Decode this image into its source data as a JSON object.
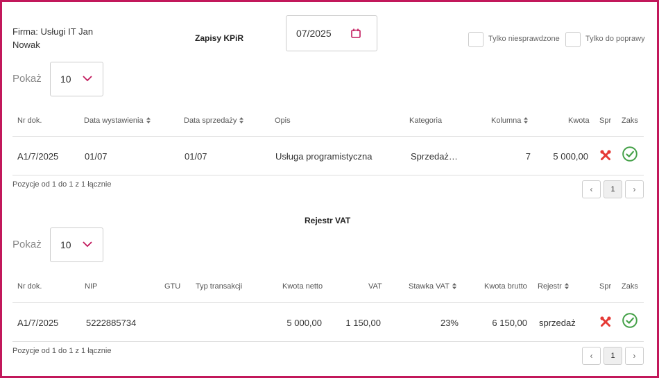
{
  "header": {
    "company": "Firma: Usługi IT Jan Nowak",
    "kpir_title": "Zapisy KPiR",
    "month": "07/2025",
    "filter_unchecked_label": "Tylko niesprawdzone",
    "filter_to_fix_label": "Tylko do poprawy"
  },
  "kpir": {
    "show_label": "Pokaż",
    "page_size": "10",
    "columns": [
      "Nr dok.",
      "Data wystawienia",
      "Data sprzedaży",
      "Opis",
      "Kategoria",
      "Kolumna",
      "Kwota",
      "Spr",
      "Zaks"
    ],
    "rows": [
      {
        "nr": "A1/7/2025",
        "issue_date": "01/07",
        "sale_date": "01/07",
        "description": "Usługa programistyczna",
        "category": "Sprzedaż…",
        "column": "7",
        "amount": "5 000,00"
      }
    ],
    "info": "Pozycje od 1 do 1 z 1 łącznie",
    "page": "1"
  },
  "vat": {
    "title": "Rejestr VAT",
    "show_label": "Pokaż",
    "page_size": "10",
    "columns": [
      "Nr dok.",
      "NIP",
      "GTU",
      "Typ transakcji",
      "Kwota netto",
      "VAT",
      "Stawka VAT",
      "Kwota brutto",
      "Rejestr",
      "Spr",
      "Zaks"
    ],
    "rows": [
      {
        "nr": "A1/7/2025",
        "nip": "5222885734",
        "gtu": "",
        "type": "",
        "net": "5 000,00",
        "vat": "1 150,00",
        "rate": "23%",
        "gross": "6 150,00",
        "register": "sprzedaż"
      }
    ],
    "info": "Pozycje od 1 do 1 z 1 łącznie",
    "page": "1"
  },
  "icons": {
    "calendar": "calendar-icon",
    "chevron": "chevron-down-icon",
    "sort": "sort-icon",
    "tools": "tools-icon",
    "verified": "check-circle-icon",
    "prev": "chevron-left-icon",
    "next": "chevron-right-icon"
  },
  "colors": {
    "accent": "#c2185b",
    "tools_red": "#e53935",
    "ok_green": "#43a047"
  }
}
